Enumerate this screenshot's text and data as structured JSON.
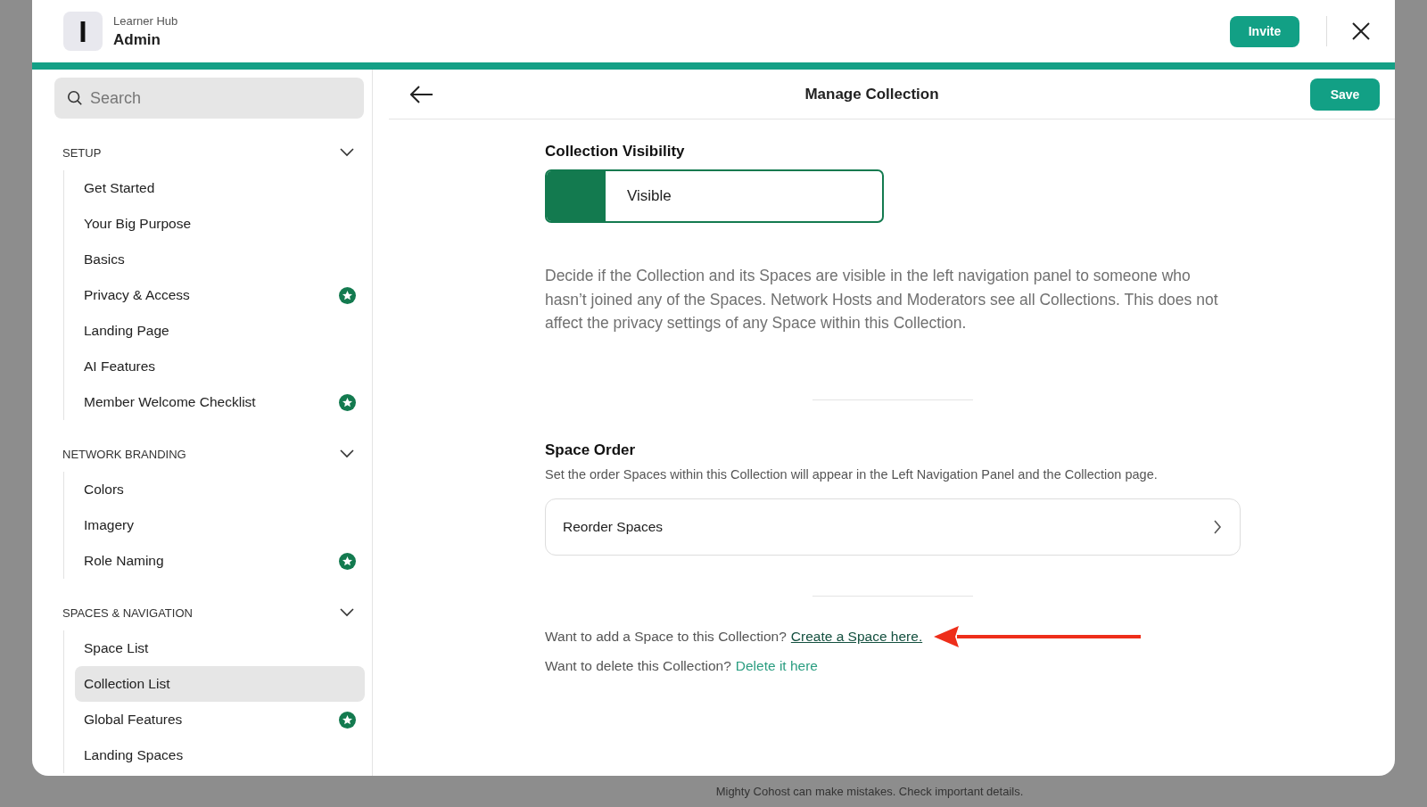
{
  "header": {
    "logo_letter": "I",
    "network": "Learner Hub",
    "title": "Admin",
    "invite": "Invite"
  },
  "sidebar": {
    "search": {
      "placeholder": "Search"
    },
    "sections": [
      {
        "title": "SETUP",
        "expanded": true,
        "items": [
          {
            "label": "Get Started",
            "selected": false,
            "starred": false
          },
          {
            "label": "Your Big Purpose",
            "selected": false,
            "starred": false
          },
          {
            "label": "Basics",
            "selected": false,
            "starred": false
          },
          {
            "label": "Privacy & Access",
            "selected": false,
            "starred": true
          },
          {
            "label": "Landing Page",
            "selected": false,
            "starred": false
          },
          {
            "label": "AI Features",
            "selected": false,
            "starred": false
          },
          {
            "label": "Member Welcome Checklist",
            "selected": false,
            "starred": true
          }
        ]
      },
      {
        "title": "NETWORK BRANDING",
        "expanded": true,
        "items": [
          {
            "label": "Colors",
            "selected": false,
            "starred": false
          },
          {
            "label": "Imagery",
            "selected": false,
            "starred": false
          },
          {
            "label": "Role Naming",
            "selected": false,
            "starred": true
          }
        ]
      },
      {
        "title": "SPACES & NAVIGATION",
        "expanded": true,
        "items": [
          {
            "label": "Space List",
            "selected": false,
            "starred": false
          },
          {
            "label": "Collection List",
            "selected": true,
            "starred": false
          },
          {
            "label": "Global Features",
            "selected": false,
            "starred": true
          },
          {
            "label": "Landing Spaces",
            "selected": false,
            "starred": false
          }
        ]
      }
    ]
  },
  "main": {
    "title": "Manage Collection",
    "save": "Save",
    "visibility": {
      "heading": "Collection Visibility",
      "value": "Visible",
      "on": true,
      "description": "Decide if the Collection and its Spaces are visible in the left navigation panel to someone who hasn’t joined any of the Spaces. Network Hosts and Moderators see all Collections. This does not affect the privacy settings of any Space within this Collection."
    },
    "order": {
      "heading": "Space Order",
      "description": "Set the order Spaces within this Collection will appear in the Left Navigation Panel and the Collection page.",
      "action": "Reorder Spaces"
    },
    "add": {
      "text": "Want to add a Space to this Collection?",
      "link": "Create a Space here."
    },
    "delete": {
      "text": "Want to delete this Collection?",
      "link": "Delete it here"
    }
  },
  "footer": "Mighty Cohost can make mistakes. Check important details."
}
